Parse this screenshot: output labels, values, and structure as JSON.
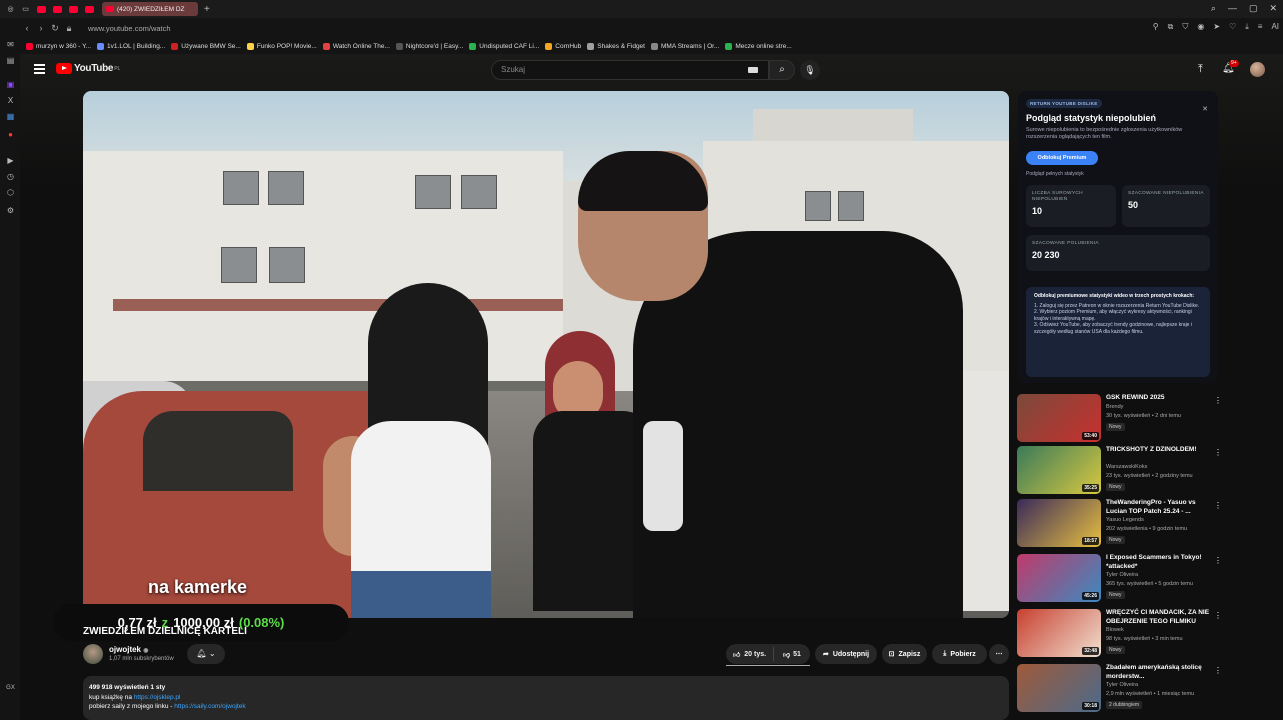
{
  "browser": {
    "active_tab": "(420) ZWIEDZIŁEM DZ",
    "url": "www.youtube.com/watch",
    "bookmarks": [
      {
        "label": "murzyn w 360 - Y...",
        "color": "#ff0033"
      },
      {
        "label": "1v1.LOL | Building...",
        "color": "#6b8cff"
      },
      {
        "label": "Używane BMW Se...",
        "color": "#cc2222"
      },
      {
        "label": "Funko POP! Movie...",
        "color": "#ffd24a"
      },
      {
        "label": "Watch Online The...",
        "color": "#e34040"
      },
      {
        "label": "Nightcore'd | Easy...",
        "color": "#555555"
      },
      {
        "label": "Undisputed CAF Li...",
        "color": "#2bb24c"
      },
      {
        "label": "CornHub",
        "color": "#f5a623"
      },
      {
        "label": "Shakes & Fidget",
        "color": "#a0a0a0"
      },
      {
        "label": "MMA Streams | Or...",
        "color": "#888888"
      },
      {
        "label": "Mecze online stre...",
        "color": "#2bb24c"
      }
    ]
  },
  "youtube": {
    "logo_text": "YouTube",
    "logo_country": "PL",
    "search_placeholder": "Szukaj",
    "notif_count": "9+"
  },
  "video": {
    "caption_text": "na kamerke",
    "caption_amount": "0,77 zł",
    "caption_z": "z",
    "caption_total": "1000,00 zł",
    "caption_pct": "(0.08%)",
    "title": "ZWIEDZIŁEM DZIELNICĘ KARTELI",
    "channel": "ojwojtek",
    "subscribers": "1,07 mln subskrybentów",
    "likes": "20 tys.",
    "dislikes": "51",
    "share": "Udostępnij",
    "save": "Zapisz",
    "download": "Pobierz"
  },
  "description": {
    "stats": "499 918 wyświetleń  1 sty",
    "line1_text": "kup książkę na",
    "line1_link": "https://ojsklep.pl",
    "line2_text": "pobierz saily z mojego linku -",
    "line2_link": "https://saily.com/ojwojtek"
  },
  "ryd": {
    "tag": "RETURN YOUTUBE DISLIKE",
    "heading": "Podgląd statystyk niepolubień",
    "sub": "Surowe niepolubienia to bezpośrednie zgłoszenia użytkowników rozszerzenia oglądających ten film.",
    "button": "Odblokuj Premium",
    "link": "Podgląd pełnych statystyk",
    "stats": [
      {
        "label": "LICZBA SUROWYCH NIEPOLUBIEŃ",
        "value": "10"
      },
      {
        "label": "SZACOWANE NIEPOLUBIENIA",
        "value": "50"
      },
      {
        "label": "SZACOWANE POLUBIENIA",
        "value": "20 230"
      }
    ],
    "promo_title": "Odblokuj premiumowe statystyki wideo w trzech prostych krokach:",
    "promo_steps": [
      "1. Zaloguj się przez Patreon w oknie rozszerzenia Return YouTube Dislike.",
      "2. Wybierz poziom Premium, aby włączyć wykresy aktywności, rankingi krajów i interaktywną mapę.",
      "3. Odśwież YouTube, aby zobaczyć trendy godzinowe, najlepsze kraje i szczegóły według stanów USA dla każdego filmu."
    ]
  },
  "recommendations": [
    {
      "title": "GSK REWIND 2025",
      "channel": "Brendy",
      "meta": "30 tys. wyświetleń • 2 dni temu",
      "badge": "Nowy",
      "duration": "53:40",
      "thumb": "#7a4a3a",
      "thumb2": "#c83030"
    },
    {
      "title": "TRICKSHOTY Z DZINOLDEM!",
      "channel": "WarszawskiKoks",
      "meta": "23 tys. wyświetleń • 2 godziny temu",
      "badge": "Nowy",
      "duration": "35:25",
      "thumb": "#3a7a5a",
      "thumb2": "#d8c840"
    },
    {
      "title": "TheWanderingPro - Yasuo vs Lucian TOP Patch 25.24 - ...",
      "channel": "Yasuo Legends",
      "meta": "202 wyświetlenia • 9 godzin temu",
      "badge": "Nowy",
      "duration": "18:57",
      "thumb": "#3a2a5a",
      "thumb2": "#e8c040"
    },
    {
      "title": "I Exposed Scammers in Tokyo! *attacked*",
      "channel": "Tyler Oliveira",
      "meta": "365 tys. wyświetleń • 5 godzin temu",
      "badge": "Nowy",
      "duration": "45:26",
      "thumb": "#c03a6a",
      "thumb2": "#3a8ac0"
    },
    {
      "title": "WRĘCZYĆ CI MANDACIK, ZA NIE OBEJRZENIE TEGO FILMIKU",
      "channel": "Blowek",
      "meta": "98 tys. wyświetleń • 3 min temu",
      "badge": "Nowy",
      "duration": "32:48",
      "thumb": "#c84030",
      "thumb2": "#f0e0d0"
    },
    {
      "title": "Zbadałem amerykańską stolicę morderstw...",
      "channel": "Tyler Oliveira",
      "meta": "2,9 mln wyświetleń • 1 miesiąc temu",
      "badge": "2 dubbingiem",
      "duration": "30:18",
      "thumb": "#a05a3a",
      "thumb2": "#4a6a8a"
    }
  ]
}
